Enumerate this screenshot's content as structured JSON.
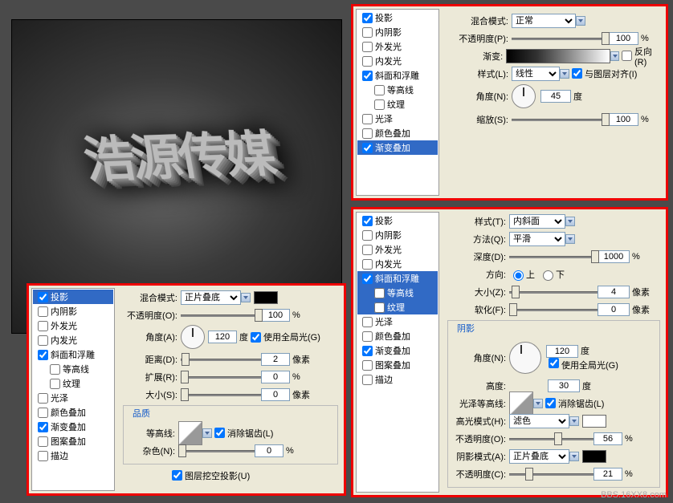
{
  "main_text": "浩源传媒",
  "styles": {
    "ds": "投影",
    "is": "内阴影",
    "og": "外发光",
    "ig": "内发光",
    "be": "斜面和浮雕",
    "con": "等高线",
    "tex": "纹理",
    "sat": "光泽",
    "co": "颜色叠加",
    "go": "渐变叠加",
    "po": "图案叠加",
    "st": "描边"
  },
  "p1": {
    "blend_l": "混合模式:",
    "blend_v": "正常",
    "opac_l": "不透明度(P):",
    "opac_v": "100",
    "pct": "%",
    "grad_l": "渐变:",
    "rev": "反向(R)",
    "style_l": "样式(L):",
    "style_v": "线性",
    "align": "与图层对齐(I)",
    "angle_l": "角度(N):",
    "angle_v": "45",
    "deg": "度",
    "scale_l": "缩放(S):",
    "scale_v": "100"
  },
  "p2": {
    "blend_l": "混合模式:",
    "blend_v": "正片叠底",
    "opac_l": "不透明度(O):",
    "opac_v": "100",
    "pct": "%",
    "angle_l": "角度(A):",
    "angle_v": "120",
    "deg": "度",
    "gl": "使用全局光(G)",
    "dist_l": "距离(D):",
    "dist_v": "2",
    "px": "像素",
    "spr_l": "扩展(R):",
    "spr_v": "0",
    "size_l": "大小(S):",
    "size_v": "0",
    "qual": "品质",
    "con_l": "等高线:",
    "aa": "消除锯齿(L)",
    "noise_l": "杂色(N):",
    "noise_v": "0",
    "knock": "图层挖空投影(U)"
  },
  "p3": {
    "style_l": "样式(T):",
    "style_v": "内斜面",
    "tech_l": "方法(Q):",
    "tech_v": "平滑",
    "depth_l": "深度(D):",
    "depth_v": "1000",
    "pct": "%",
    "dir_l": "方向:",
    "up": "上",
    "dn": "下",
    "size_l": "大小(Z):",
    "size_v": "4",
    "px": "像素",
    "soft_l": "软化(F):",
    "soft_v": "0",
    "shade": "阴影",
    "angle_l": "角度(N):",
    "angle_v": "120",
    "deg": "度",
    "gl": "使用全局光(G)",
    "alt_l": "高度:",
    "alt_v": "30",
    "gc_l": "光泽等高线:",
    "aa": "消除锯齿(L)",
    "hm_l": "高光模式(H):",
    "hm_v": "滤色",
    "ho_l": "不透明度(O):",
    "ho_v": "56",
    "sm_l": "阴影模式(A):",
    "sm_v": "正片叠底",
    "so_l": "不透明度(C):",
    "so_v": "21"
  },
  "wm": "BBS.16XX8.com"
}
